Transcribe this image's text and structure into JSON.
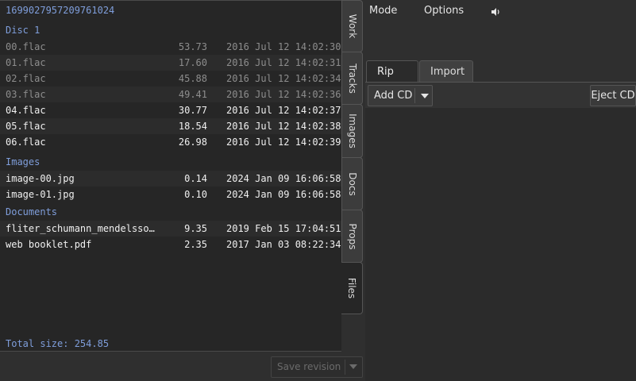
{
  "release_id": "1699027957209761024",
  "sections": {
    "disc1": "Disc 1",
    "images": "Images",
    "documents": "Documents"
  },
  "disc1_files": [
    {
      "name": "00.flac",
      "size": "53.73",
      "date": "2016 Jul 12 14:02:30"
    },
    {
      "name": "01.flac",
      "size": "17.60",
      "date": "2016 Jul 12 14:02:31"
    },
    {
      "name": "02.flac",
      "size": "45.88",
      "date": "2016 Jul 12 14:02:34"
    },
    {
      "name": "03.flac",
      "size": "49.41",
      "date": "2016 Jul 12 14:02:36"
    },
    {
      "name": "04.flac",
      "size": "30.77",
      "date": "2016 Jul 12 14:02:37"
    },
    {
      "name": "05.flac",
      "size": "18.54",
      "date": "2016 Jul 12 14:02:38"
    },
    {
      "name": "06.flac",
      "size": "26.98",
      "date": "2016 Jul 12 14:02:39"
    }
  ],
  "image_files": [
    {
      "name": "image-00.jpg",
      "size": "0.14",
      "date": "2024 Jan 09 16:06:58"
    },
    {
      "name": "image-01.jpg",
      "size": "0.10",
      "date": "2024 Jan 09 16:06:58"
    }
  ],
  "document_files": [
    {
      "name": "fliter_schumann_mendelssoh…",
      "size": "9.35",
      "date": "2019 Feb 15 17:04:51"
    },
    {
      "name": "web booklet.pdf",
      "size": "2.35",
      "date": "2017 Jan 03 08:22:34"
    }
  ],
  "total_size": "Total size: 254.85",
  "side_tabs": [
    "Work",
    "Tracks",
    "Images",
    "Docs",
    "Props",
    "Files"
  ],
  "active_side_tab": "Files",
  "save_revision_label": "Save revision",
  "menu": {
    "mode": "Mode",
    "options": "Options"
  },
  "speaker_icon": "speaker-icon",
  "tabs": {
    "rip_cd": "Rip CD",
    "import": "Import",
    "active": "Rip CD"
  },
  "buttons": {
    "add_cd": "Add CD",
    "eject_cd": "Eject CD"
  },
  "colors": {
    "accent": "#7f9edb",
    "panel": "#262626",
    "background": "#2f2f2f"
  }
}
